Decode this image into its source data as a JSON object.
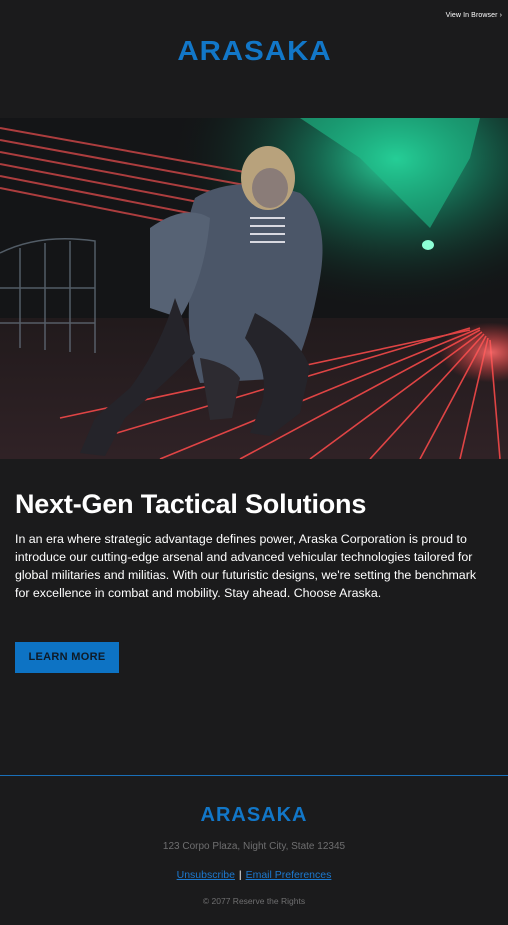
{
  "header": {
    "view_in_browser": "View In Browser",
    "view_in_browser_chevron": "›",
    "logo_text": "ARASAKA"
  },
  "hero": {
    "image_alt": "Person crouching in a dark tunnel with red laser lines and green lights"
  },
  "main": {
    "headline": "Next-Gen Tactical Solutions",
    "body": "In an era where strategic advantage defines power, Araska Corporation is proud to introduce our cutting-edge arsenal and advanced vehicular technologies tailored for global militaries and militias. With our futuristic designs, we're setting the benchmark for excellence in combat and mobility. Stay ahead. Choose Araska.",
    "cta_label": "LEARN MORE"
  },
  "footer": {
    "logo_text": "ARASAKA",
    "address": "123 Corpo Plaza, Night City, State 12345",
    "unsubscribe_label": "Unsubscribe",
    "separator": "|",
    "preferences_label": "Email Preferences",
    "copyright": "© 2077 Reserve the Rights"
  },
  "colors": {
    "background": "#1b1b1c",
    "brand_blue": "#1277c8",
    "cta_blue": "#0d73c4",
    "divider": "#1a6fb8",
    "muted_text": "#6f6f70"
  }
}
